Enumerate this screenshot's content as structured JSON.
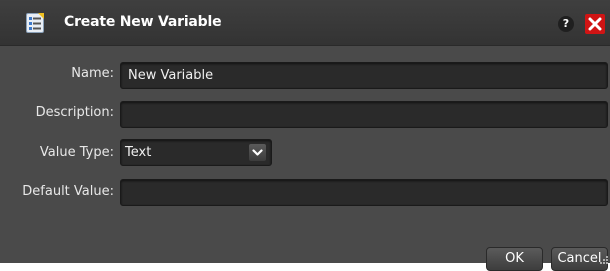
{
  "dialog": {
    "title": "Create New Variable",
    "help_label": "?",
    "icons": {
      "title_icon": "variable-list-icon",
      "help": "help-icon",
      "close": "close-icon",
      "dropdown": "chevron-down-icon",
      "resize": "resize-grip-icon"
    }
  },
  "form": {
    "name_label": "Name:",
    "name_value": "New Variable",
    "description_label": "Description:",
    "description_value": "",
    "value_type_label": "Value Type:",
    "value_type_selected": "Text",
    "default_value_label": "Default Value:",
    "default_value_value": ""
  },
  "buttons": {
    "ok_label": "OK",
    "cancel_label": "Cancel"
  },
  "colors": {
    "background": "#4a4a4a",
    "titlebar": "#333333",
    "field": "#2a2a2a",
    "close": "#d01414"
  }
}
